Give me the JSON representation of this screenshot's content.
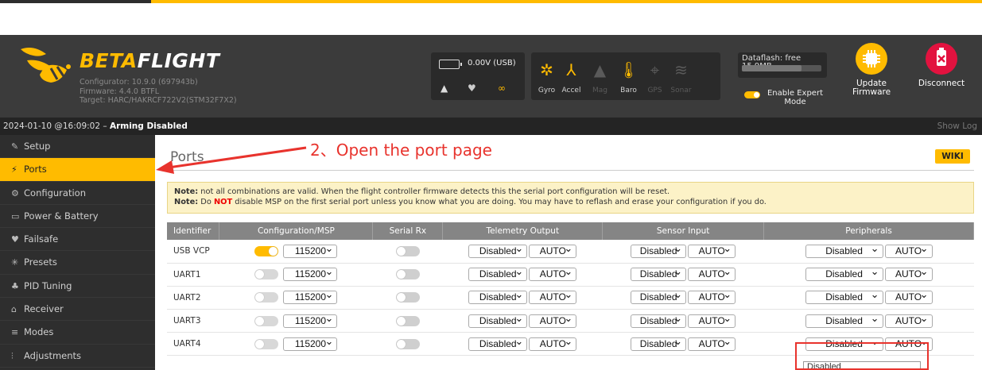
{
  "header": {
    "logo": {
      "beta": "BETA",
      "flight": "FLIGHT"
    },
    "configurator": "Configurator: 10.9.0 (697943b)",
    "firmware": "Firmware: 4.4.0 BTFL",
    "target": "Target: HARC/HAKRCF722V2(STM32F7X2)",
    "battery": "0.00V (USB)",
    "sensors": [
      {
        "label": "Gyro",
        "icon": "gyro-icon",
        "active": true
      },
      {
        "label": "Accel",
        "icon": "accel-icon",
        "active": true
      },
      {
        "label": "Mag",
        "icon": "mag-icon",
        "active": false
      },
      {
        "label": "Baro",
        "icon": "baro-icon",
        "active": true
      },
      {
        "label": "GPS",
        "icon": "gps-icon",
        "active": false
      },
      {
        "label": "Sonar",
        "icon": "sonar-icon",
        "active": false
      }
    ],
    "dataflash_label": "Dataflash: free",
    "dataflash_value": "15.9MB",
    "dataflash_used_fraction": 0.75,
    "expert_mode": "Enable Expert Mode",
    "update_firmware": "Update Firmware",
    "disconnect": "Disconnect",
    "colors": {
      "accent": "#ffbb00",
      "disconnect": "#e2123f"
    }
  },
  "status": {
    "timestamp": "2024-01-10 @16:09:02 –",
    "state": "Arming Disabled",
    "show_log": "Show Log"
  },
  "sidebar": {
    "items": [
      {
        "label": "Setup",
        "icon": "wrench-icon"
      },
      {
        "label": "Ports",
        "icon": "plug-icon",
        "active": true
      },
      {
        "label": "Configuration",
        "icon": "gear-icon"
      },
      {
        "label": "Power & Battery",
        "icon": "battery-icon"
      },
      {
        "label": "Failsafe",
        "icon": "parachute-icon"
      },
      {
        "label": "Presets",
        "icon": "presets-icon"
      },
      {
        "label": "PID Tuning",
        "icon": "pid-icon"
      },
      {
        "label": "Receiver",
        "icon": "receiver-icon"
      },
      {
        "label": "Modes",
        "icon": "modes-icon"
      },
      {
        "label": "Adjustments",
        "icon": "adjustments-icon"
      }
    ]
  },
  "main": {
    "title": "Ports",
    "wiki": "WIKI",
    "note1_label": "Note:",
    "note1_text": " not all combinations are valid. When the flight controller firmware detects this the serial port configuration will be reset.",
    "note2_label": "Note:",
    "note2_pre": " Do ",
    "note2_not": "NOT",
    "note2_post": " disable MSP on the first serial port unless you know what you are doing. You may have to reflash and erase your configuration if you do.",
    "columns": [
      "Identifier",
      "Configuration/MSP",
      "Serial Rx",
      "Telemetry Output",
      "Sensor Input",
      "Peripherals"
    ],
    "rows": [
      {
        "id": "USB VCP",
        "msp": true,
        "baud": "115200",
        "telemetry": "Disabled",
        "telemetry_baud": "AUTO",
        "sensor": "Disabled",
        "sensor_baud": "AUTO",
        "peripheral": "Disabled",
        "peripheral_baud": "AUTO"
      },
      {
        "id": "UART1",
        "msp": false,
        "baud": "115200",
        "telemetry": "Disabled",
        "telemetry_baud": "AUTO",
        "sensor": "Disabled",
        "sensor_baud": "AUTO",
        "peripheral": "Disabled",
        "peripheral_baud": "AUTO"
      },
      {
        "id": "UART2",
        "msp": false,
        "baud": "115200",
        "telemetry": "Disabled",
        "telemetry_baud": "AUTO",
        "sensor": "Disabled",
        "sensor_baud": "AUTO",
        "peripheral": "Disabled",
        "peripheral_baud": "AUTO"
      },
      {
        "id": "UART3",
        "msp": false,
        "baud": "115200",
        "telemetry": "Disabled",
        "telemetry_baud": "AUTO",
        "sensor": "Disabled",
        "sensor_baud": "AUTO",
        "peripheral": "Disabled",
        "peripheral_baud": "AUTO"
      },
      {
        "id": "UART4",
        "msp": false,
        "baud": "115200",
        "telemetry": "Disabled",
        "telemetry_baud": "AUTO",
        "sensor": "Disabled",
        "sensor_baud": "AUTO",
        "peripheral": "Disabled",
        "peripheral_baud": "AUTO"
      }
    ],
    "dropdown_option": "Disabled"
  },
  "annotation": {
    "text": "2、Open the port page",
    "color": "#e8332d"
  }
}
